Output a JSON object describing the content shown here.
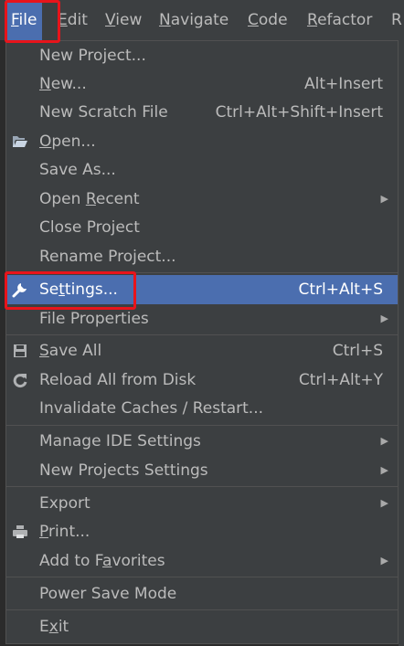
{
  "menubar": {
    "items": [
      {
        "label": "File",
        "mnemonic": "F",
        "rest": "ile"
      },
      {
        "label": "Edit",
        "mnemonic": "E",
        "rest": "dit"
      },
      {
        "label": "View",
        "mnemonic": "V",
        "rest": "iew"
      },
      {
        "label": "Navigate",
        "mnemonic": "N",
        "rest": "avigate"
      },
      {
        "label": "Code",
        "mnemonic": "C",
        "rest": "ode"
      },
      {
        "label": "Refactor",
        "mnemonic": "R",
        "rest": "efactor"
      },
      {
        "label": "R",
        "mnemonic": "R",
        "rest": ""
      }
    ]
  },
  "file_menu": {
    "items": [
      {
        "pre": "New Project...",
        "mn": "",
        "post": "",
        "shortcut": ""
      },
      {
        "pre": "",
        "mn": "N",
        "post": "ew...",
        "shortcut": "Alt+Insert"
      },
      {
        "pre": "New Scratch File",
        "mn": "",
        "post": "",
        "shortcut": "Ctrl+Alt+Shift+Insert"
      },
      {
        "pre": "",
        "mn": "O",
        "post": "pen...",
        "shortcut": ""
      },
      {
        "pre": "Save As...",
        "mn": "",
        "post": "",
        "shortcut": ""
      },
      {
        "pre": "Open ",
        "mn": "R",
        "post": "ecent",
        "shortcut": ""
      },
      {
        "pre": "Close Project",
        "mn": "",
        "post": "",
        "shortcut": ""
      },
      {
        "pre": "Rename Project...",
        "mn": "",
        "post": "",
        "shortcut": ""
      },
      {
        "pre": "Se",
        "mn": "t",
        "post": "tings...",
        "shortcut": "Ctrl+Alt+S"
      },
      {
        "pre": "File Properties",
        "mn": "",
        "post": "",
        "shortcut": ""
      },
      {
        "pre": "",
        "mn": "S",
        "post": "ave All",
        "shortcut": "Ctrl+S"
      },
      {
        "pre": "Reload All from Disk",
        "mn": "",
        "post": "",
        "shortcut": "Ctrl+Alt+Y"
      },
      {
        "pre": "Invalidate Caches / Restart...",
        "mn": "",
        "post": "",
        "shortcut": ""
      },
      {
        "pre": "Manage IDE Settings",
        "mn": "",
        "post": "",
        "shortcut": ""
      },
      {
        "pre": "New Projects Settings",
        "mn": "",
        "post": "",
        "shortcut": ""
      },
      {
        "pre": "Export",
        "mn": "",
        "post": "",
        "shortcut": ""
      },
      {
        "pre": "",
        "mn": "P",
        "post": "rint...",
        "shortcut": ""
      },
      {
        "pre": "Add to F",
        "mn": "a",
        "post": "vorites",
        "shortcut": ""
      },
      {
        "pre": "Power Save Mode",
        "mn": "",
        "post": "",
        "shortcut": ""
      },
      {
        "pre": "E",
        "mn": "x",
        "post": "it",
        "shortcut": ""
      }
    ]
  },
  "icons": {
    "folder": "folder-open-icon",
    "wrench": "wrench-icon",
    "save": "floppy-disk-icon",
    "reload": "reload-icon",
    "print": "printer-icon",
    "submenu": "chevron-right-icon"
  },
  "colors": {
    "menu_bg": "#3c3f41",
    "selection": "#4b6eaf",
    "highlight_annotation": "#e8141b",
    "text": "#bbbbbb"
  }
}
